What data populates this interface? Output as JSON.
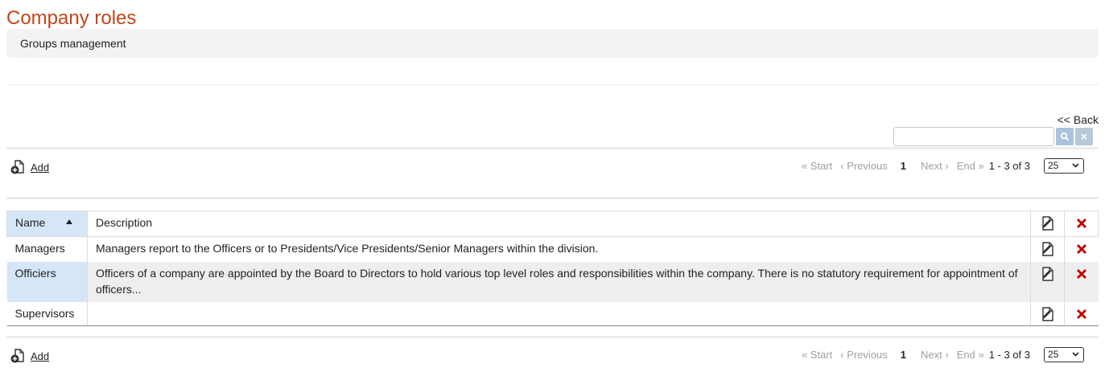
{
  "page": {
    "title": "Company roles",
    "subtitle": "Groups management",
    "back_label": "<< Back"
  },
  "search": {
    "value": "",
    "placeholder": "",
    "go_icon": "search-icon",
    "clear_icon": "close-icon"
  },
  "toolbar": {
    "add_label": "Add",
    "add_icon": "add-document-icon"
  },
  "pager": {
    "start": "« Start",
    "previous": "‹ Previous",
    "current_page": "1",
    "next": "Next ›",
    "end": "End »",
    "range": "1 - 3 of 3",
    "page_size": "25"
  },
  "table": {
    "columns": [
      "Name",
      "Description"
    ],
    "sort": {
      "column": "Name",
      "direction": "ascending"
    },
    "rows": [
      {
        "name": "Managers",
        "description": "Managers report to the Officers or to Presidents/Vice Presidents/Senior Managers within the division."
      },
      {
        "name": "Officiers",
        "description": "Officers of a company are appointed by the Board to Directors to hold various top level roles and responsibilities within the company. There is no statutory requirement for appointment of officers..."
      },
      {
        "name": "Supervisors",
        "description": ""
      }
    ],
    "row_actions": [
      "edit-icon",
      "delete-icon"
    ]
  },
  "colors": {
    "title": "#c0461b",
    "selected_row": "#d4e6f8",
    "delete": "#c00000"
  }
}
